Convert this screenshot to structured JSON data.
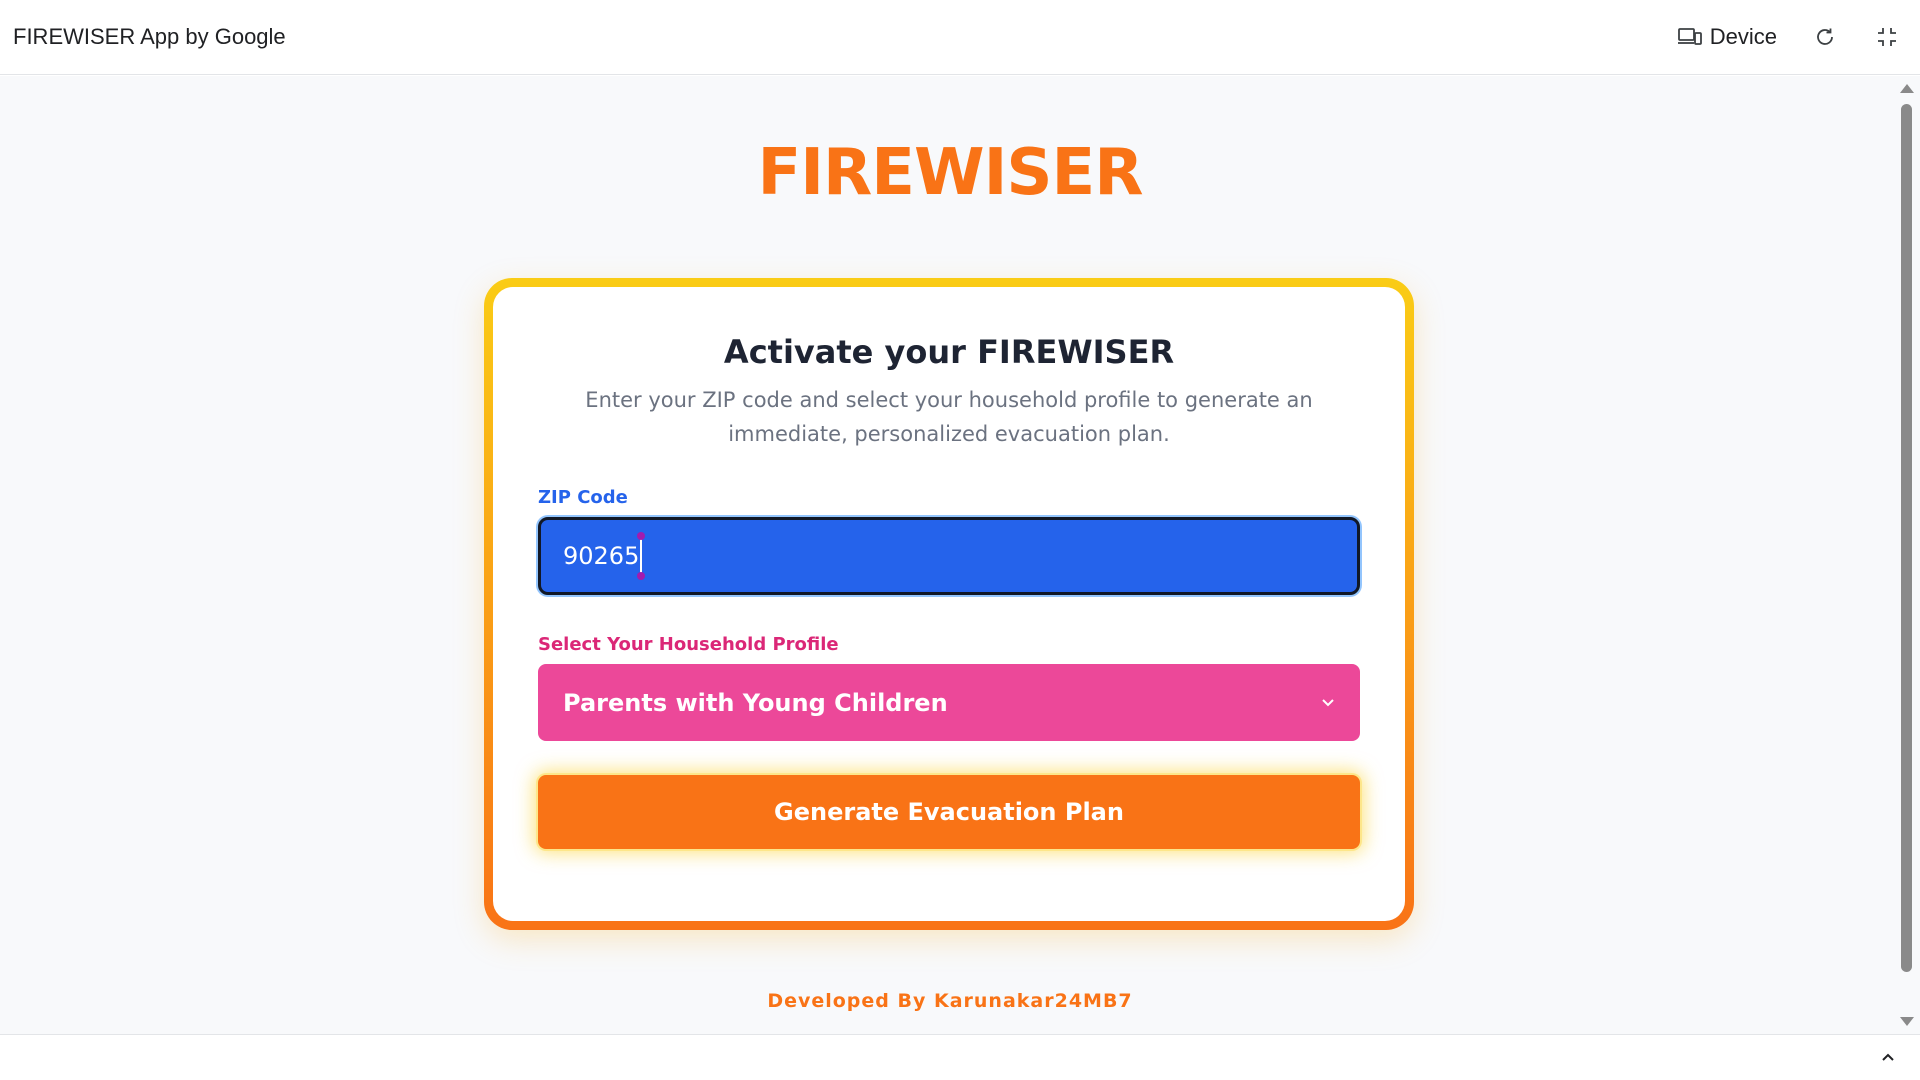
{
  "window": {
    "title": "FIREWISER App by Google",
    "device_label": "Device"
  },
  "app": {
    "brand": "FIREWISER",
    "card": {
      "title": "Activate your FIREWISER",
      "subtitle": "Enter your ZIP code and select your household profile to generate an immediate, personalized evacuation plan.",
      "zip_label": "ZIP Code",
      "zip_value": "90265",
      "profile_label": "Select Your Household Profile",
      "profile_value": "Parents with Young Children",
      "generate_label": "Generate Evacuation Plan"
    },
    "footer": "Developed By Karunakar24MB7"
  },
  "icons": {
    "device": "device-icon",
    "reload": "reload-icon",
    "fullscreen": "fullscreen-icon",
    "dropdown": "chevron-down-icon",
    "collapse": "chevron-up-icon"
  },
  "colors": {
    "accent_orange": "#f97316",
    "accent_yellow": "#facc15",
    "zip_blue": "#2563eb",
    "profile_pink": "#ec4899"
  }
}
